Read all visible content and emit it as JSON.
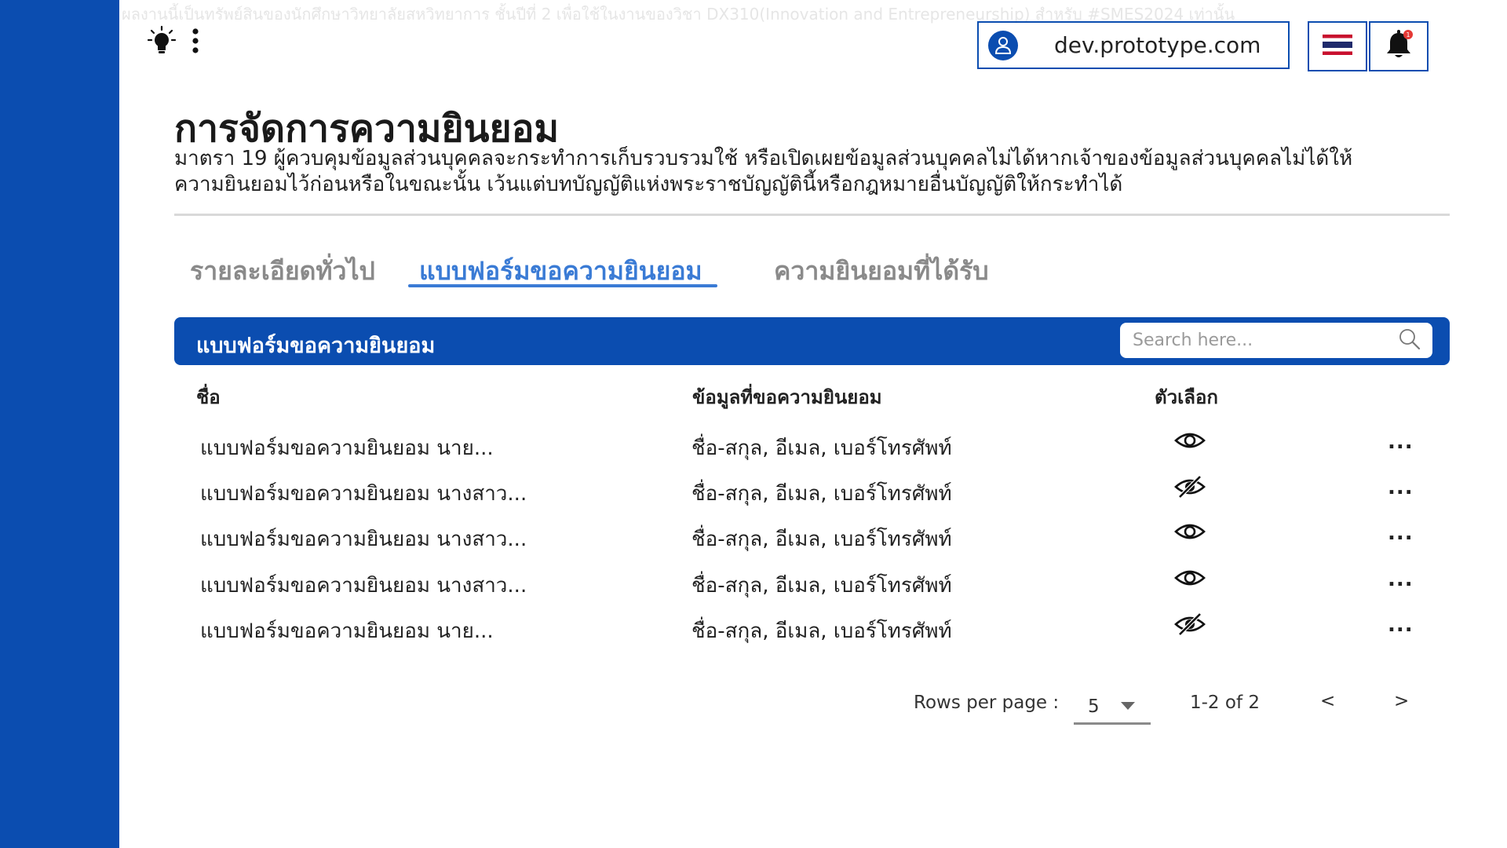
{
  "watermark": "ผลงานนี้เป็นทรัพย์สินของนักศึกษาวิทยาลัยสหวิทยาการ ชั้นปีที่ 2 เพื่อใช้ในงานของวิชา DX310(Innovation and Entrepreneurship) สำหรับ #SMES2024 เท่านั้น",
  "header": {
    "url": "dev.prototype.com",
    "notification_count": "1"
  },
  "page": {
    "title": "การจัดการความยินยอม",
    "description": "มาตรา 19 ผู้ควบคุมข้อมูลส่วนบุคคลจะกระทำการเก็บรวบรวมใช้ หรือเปิดเผยข้อมูลส่วนบุคคลไม่ได้หากเจ้าของข้อมูลส่วนบุคคลไม่ได้ให้ความยินยอมไว้ก่อนหรือในขณะนั้น เว้นแต่บทบัญญัติแห่งพระราชบัญญัตินี้หรือกฎหมายอื่นบัญญัติให้กระทำได้"
  },
  "tabs": [
    {
      "label": "รายละเอียดทั่วไป",
      "active": false
    },
    {
      "label": "แบบฟอร์มขอความยินยอม",
      "active": true
    },
    {
      "label": "ความยินยอมที่ได้รับ",
      "active": false
    }
  ],
  "table": {
    "title": "แบบฟอร์มขอความยินยอม",
    "search_placeholder": "Search here...",
    "columns": [
      "ชื่อ",
      "ข้อมูลที่ขอความยินยอม",
      "ตัวเลือก"
    ],
    "rows": [
      {
        "name": "แบบฟอร์มขอความยินยอม นาย...",
        "data": "ชื่อ-สกุล, อีเมล, เบอร์โทรศัพท์",
        "visibility": "visible",
        "more": "..."
      },
      {
        "name": "แบบฟอร์มขอความยินยอม นางสาว...",
        "data": "ชื่อ-สกุล, อีเมล, เบอร์โทรศัพท์",
        "visibility": "hidden",
        "more": "..."
      },
      {
        "name": "แบบฟอร์มขอความยินยอม นางสาว...",
        "data": "ชื่อ-สกุล, อีเมล, เบอร์โทรศัพท์",
        "visibility": "visible",
        "more": "..."
      },
      {
        "name": "แบบฟอร์มขอความยินยอม นางสาว...",
        "data": "ชื่อ-สกุล, อีเมล, เบอร์โทรศัพท์",
        "visibility": "visible",
        "more": "..."
      },
      {
        "name": "แบบฟอร์มขอความยินยอม นาย...",
        "data": "ชื่อ-สกุล, อีเมล, เบอร์โทรศัพท์",
        "visibility": "hidden",
        "more": "..."
      }
    ]
  },
  "pagination": {
    "rows_per_page_label": "Rows per page :",
    "rows_per_page_value": "5",
    "range": "1-2 of 2",
    "prev": "<",
    "next": ">"
  },
  "colors": {
    "brand_blue": "#0b4db0",
    "active_tab": "#3a7bd5",
    "inactive_tab": "#8a8a8a",
    "notification_badge": "#e53935"
  },
  "icons": {
    "theme": "lightbulb-icon",
    "menu": "kebab-menu-icon",
    "user": "user-icon",
    "language": "thai-flag-icon",
    "notifications": "bell-icon",
    "search": "search-icon",
    "visible": "eye-icon",
    "hidden": "eye-slash-icon",
    "more": "more-icon"
  }
}
